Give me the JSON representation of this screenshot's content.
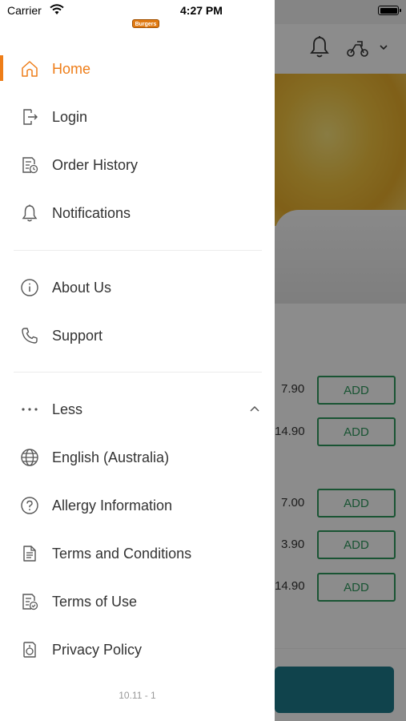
{
  "status_bar": {
    "carrier": "Carrier",
    "time": "4:27 PM"
  },
  "brand": {
    "logo_text": "Burgers",
    "accent_color": "#ee7d18"
  },
  "drawer": {
    "items": [
      {
        "label": "Home",
        "icon": "home-icon",
        "active": true
      },
      {
        "label": "Login",
        "icon": "login-icon"
      },
      {
        "label": "Order History",
        "icon": "order-history-icon"
      },
      {
        "label": "Notifications",
        "icon": "bell-icon"
      },
      {
        "label": "About Us",
        "icon": "info-icon"
      },
      {
        "label": "Support",
        "icon": "phone-icon"
      },
      {
        "label": "Less",
        "icon": "more-dots-icon"
      },
      {
        "label": "English (Australia)",
        "icon": "globe-icon"
      },
      {
        "label": "Allergy Information",
        "icon": "question-icon"
      },
      {
        "label": "Terms and Conditions",
        "icon": "document-icon"
      },
      {
        "label": "Terms of Use",
        "icon": "document-check-icon"
      },
      {
        "label": "Privacy Policy",
        "icon": "privacy-icon"
      }
    ],
    "version": "10.11 - 1"
  },
  "background": {
    "items": [
      {
        "price": "7.90",
        "button": "ADD"
      },
      {
        "price": "14.90",
        "button": "ADD"
      },
      {
        "price": "7.00",
        "button": "ADD"
      },
      {
        "price": "3.90",
        "button": "ADD"
      },
      {
        "price": "14.90",
        "button": "ADD"
      }
    ],
    "add_color": "#2e9a5e"
  }
}
